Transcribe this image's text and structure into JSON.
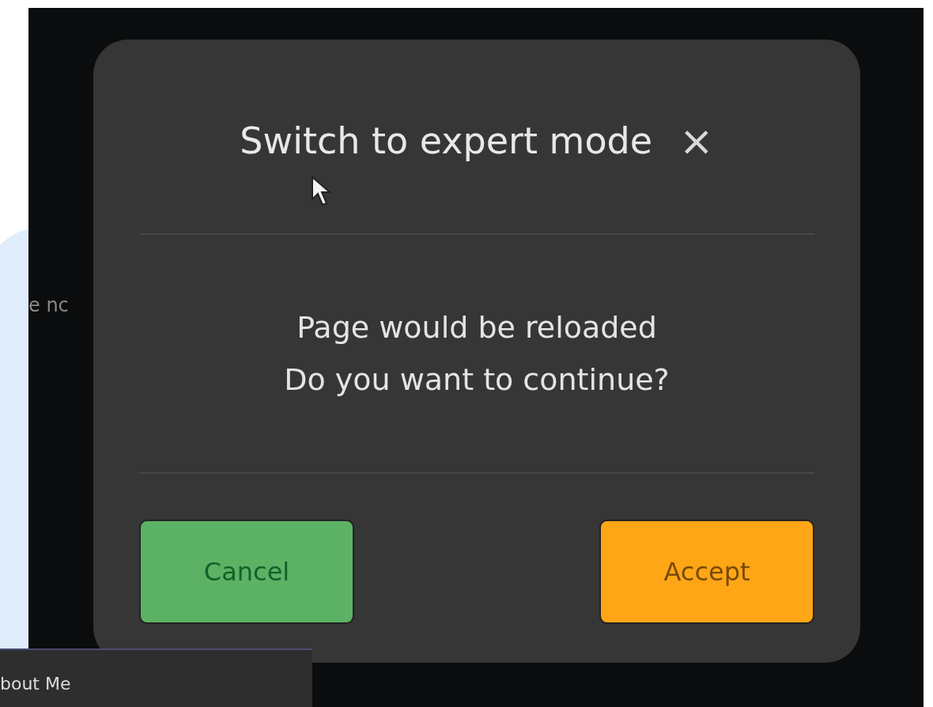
{
  "backdrop": {
    "partial_text": "e nc"
  },
  "dialog": {
    "title": "Switch to expert mode",
    "close_label": "×",
    "message_lines": [
      "Page would be reloaded",
      "Do you want to continue?"
    ],
    "buttons": [
      {
        "label": "Cancel",
        "kind": "cancel"
      },
      {
        "label": "Accept",
        "kind": "accept"
      }
    ]
  },
  "footer_tab": {
    "label": "bout Me"
  }
}
